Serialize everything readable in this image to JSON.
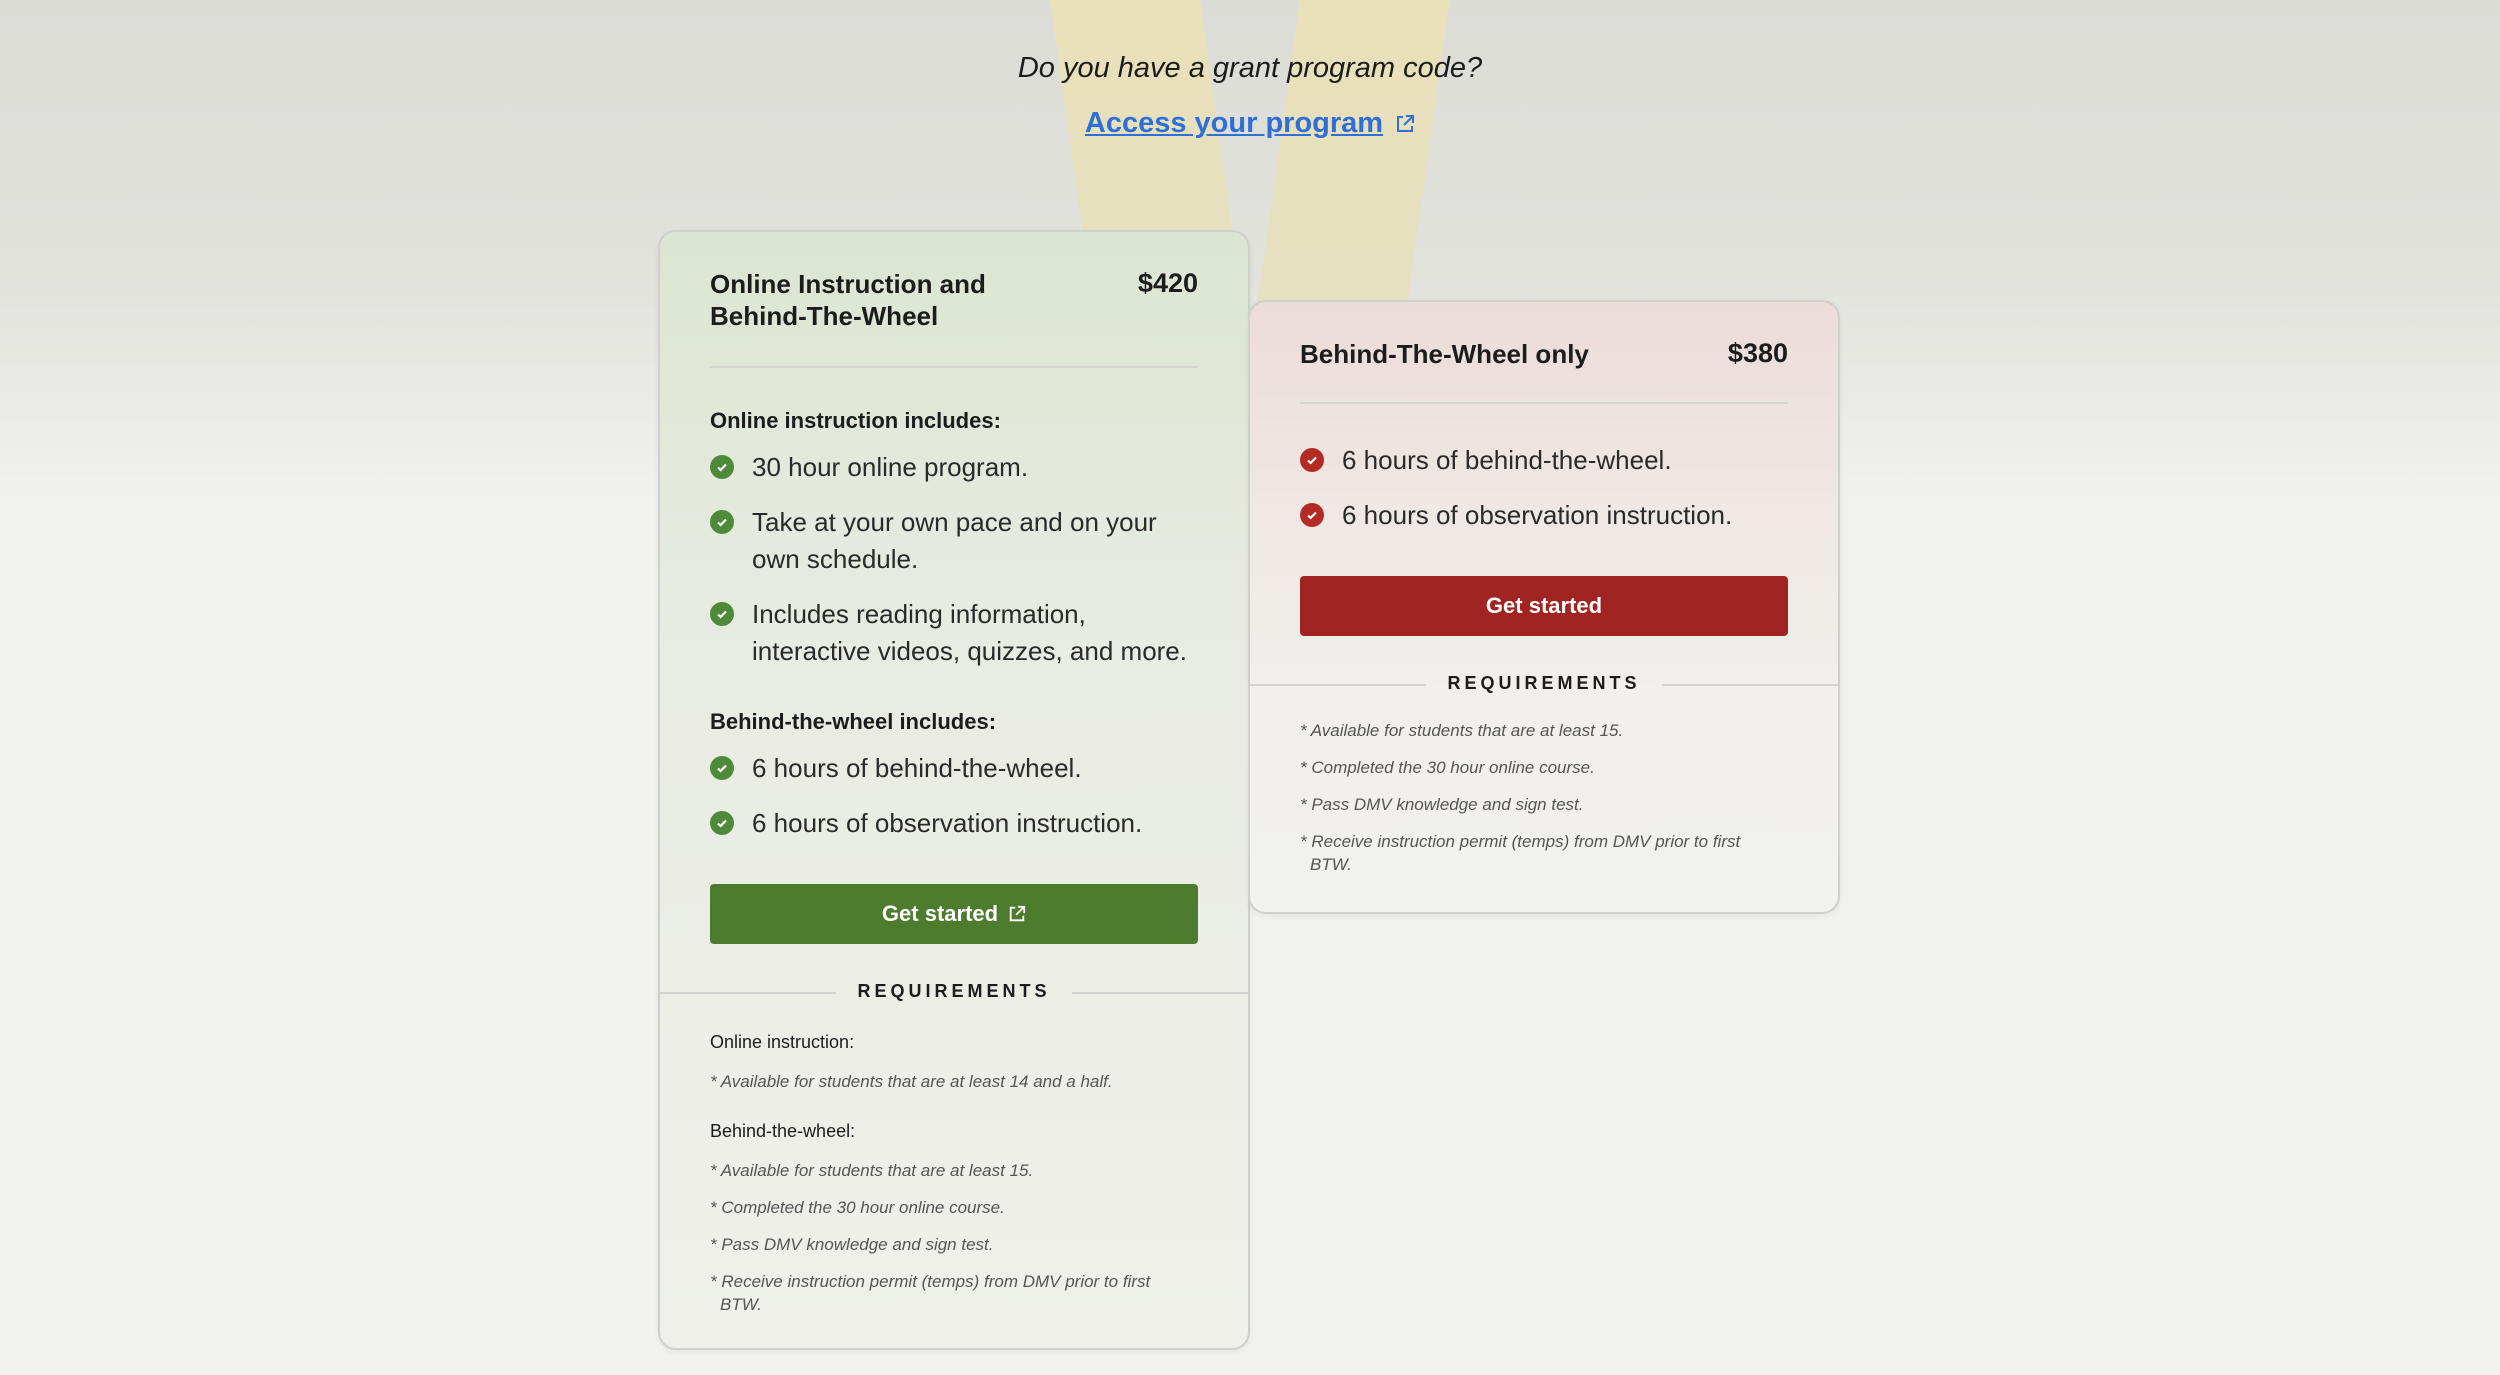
{
  "grant": {
    "question": "Do you have a grant program code?",
    "link_label": "Access your program"
  },
  "colors": {
    "link": "#2f6fd8",
    "green": "#4d7c2f",
    "red": "#a02421"
  },
  "plans": {
    "combo": {
      "title": "Online Instruction and Behind-The-Wheel",
      "price": "$420",
      "online_heading": "Online instruction includes:",
      "online_features": [
        "30 hour online program.",
        "Take at your own pace and on your own schedule.",
        "Includes reading information, interactive videos, quizzes, and more."
      ],
      "btw_heading": "Behind-the-wheel includes:",
      "btw_features": [
        "6 hours of behind-the-wheel.",
        "6 hours of observation instruction."
      ],
      "button_label": "Get started",
      "requirements_label": "REQUIREMENTS",
      "req_online_heading": "Online instruction:",
      "req_online_items": [
        "* Available for students that are at least 14 and a half."
      ],
      "req_btw_heading": "Behind-the-wheel:",
      "req_btw_items": [
        "* Available for students that are at least 15.",
        "* Completed the 30 hour online course.",
        "* Pass DMV knowledge and sign test.",
        "* Receive instruction permit (temps) from DMV prior to first BTW."
      ]
    },
    "btw": {
      "title": "Behind-The-Wheel only",
      "price": "$380",
      "features": [
        "6 hours of behind-the-wheel.",
        "6 hours of observation instruction."
      ],
      "button_label": "Get started",
      "requirements_label": "REQUIREMENTS",
      "req_items": [
        "* Available for students that are at least 15.",
        "* Completed the 30 hour online course.",
        "* Pass DMV knowledge and sign test.",
        "* Receive instruction permit (temps) from DMV prior to first BTW."
      ]
    }
  }
}
